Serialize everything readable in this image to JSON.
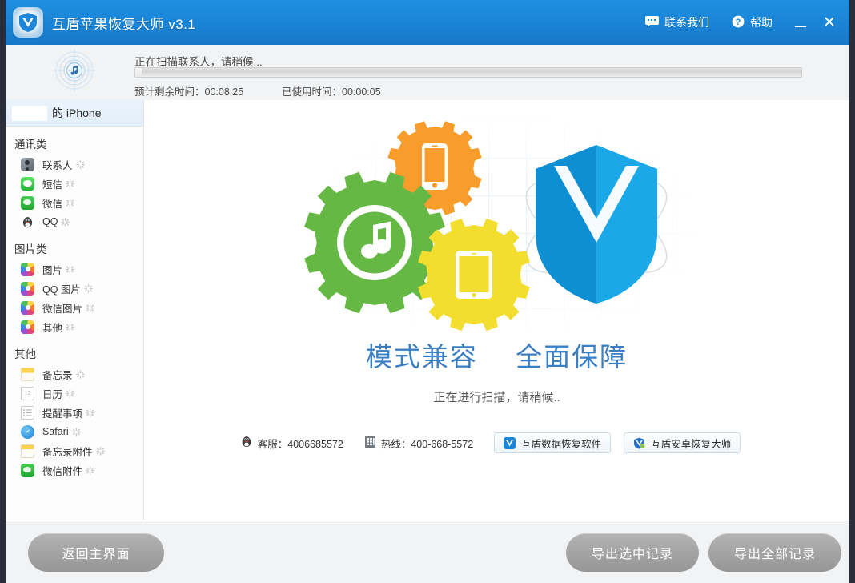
{
  "titlebar": {
    "app_title": "互盾苹果恢复大师 v3.1",
    "logo_icon": "shield-logo-icon",
    "contact_label": "联系我们",
    "contact_icon": "chat-bubble-icon",
    "help_label": "帮助",
    "help_icon": "question-circle-icon",
    "minimize_icon": "minimize-icon",
    "close_icon": "close-icon",
    "close_glyph": "✕",
    "accent_color": "#1b86d8"
  },
  "scan": {
    "status_text": "正在扫描联系人，请稍候...",
    "scan_icon": "radar-music-scan-icon",
    "progress_percent": 1,
    "remaining_label": "预计剩余时间：00:08:25",
    "elapsed_label": "已使用时间：00:00:05"
  },
  "sidebar": {
    "device_name": "的 iPhone",
    "groups": [
      {
        "title": "通讯类",
        "items": [
          {
            "label": "联系人",
            "icon": "contacts-icon",
            "icon_class": "i-contacts",
            "loading": true
          },
          {
            "label": "短信",
            "icon": "sms-icon",
            "icon_class": "i-sms",
            "loading": true
          },
          {
            "label": "微信",
            "icon": "wechat-icon",
            "icon_class": "i-wechat",
            "loading": true
          },
          {
            "label": "QQ",
            "icon": "qq-penguin-icon",
            "icon_class": "i-qq",
            "loading": true
          }
        ]
      },
      {
        "title": "图片类",
        "items": [
          {
            "label": "图片",
            "icon": "photos-icon",
            "icon_class": "i-photos",
            "loading": true
          },
          {
            "label": "QQ 图片",
            "icon": "qq-photos-icon",
            "icon_class": "i-photos",
            "loading": true
          },
          {
            "label": "微信图片",
            "icon": "wechat-photos-icon",
            "icon_class": "i-photos",
            "loading": true
          },
          {
            "label": "其他",
            "icon": "other-photos-icon",
            "icon_class": "i-photos",
            "loading": true
          }
        ]
      },
      {
        "title": "其他",
        "items": [
          {
            "label": "备忘录",
            "icon": "notes-icon",
            "icon_class": "i-notes",
            "loading": true
          },
          {
            "label": "日历",
            "icon": "calendar-icon",
            "icon_class": "i-cal",
            "loading": true
          },
          {
            "label": "提醒事项",
            "icon": "reminders-icon",
            "icon_class": "i-remind",
            "loading": true
          },
          {
            "label": "Safari",
            "icon": "safari-icon",
            "icon_class": "i-safari",
            "loading": true
          },
          {
            "label": "备忘录附件",
            "icon": "notes-attachment-icon",
            "icon_class": "i-noteatt",
            "loading": true
          },
          {
            "label": "微信附件",
            "icon": "wechat-attachment-icon",
            "icon_class": "i-wxatt",
            "loading": true
          }
        ]
      }
    ]
  },
  "main": {
    "illustration_name": "gears-shield-illustration",
    "tagline_left": "模式兼容",
    "tagline_right": "全面保障",
    "tagline_color": "#3a7fc4",
    "sub_status": "正在进行扫描，请稍候..",
    "contacts": {
      "service_icon": "qq-penguin-icon",
      "service_label": "客服：4006685572",
      "hotline_icon": "telephone-icon",
      "hotline_label": "热线：400-668-5572",
      "product_1_label": "互盾数据恢复软件",
      "product_1_icon": "shield-blue-icon",
      "product_2_label": "互盾安卓恢复大师",
      "product_2_icon": "shield-android-icon"
    }
  },
  "footer": {
    "back_label": "返回主界面",
    "export_selected_label": "导出选中记录",
    "export_all_label": "导出全部记录"
  }
}
